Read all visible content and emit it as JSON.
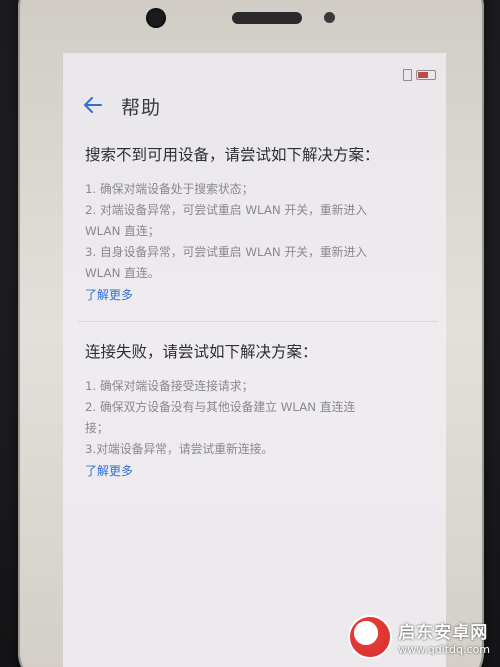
{
  "header": {
    "title": "帮助"
  },
  "sections": [
    {
      "title": "搜索不到可用设备，请尝试如下解决方案：",
      "lines": [
        "1. 确保对端设备处于搜索状态；",
        "2. 对端设备异常，可尝试重启 WLAN 开关，重新进入",
        "WLAN 直连；",
        "3. 自身设备异常，可尝试重启 WLAN 开关，重新进入",
        "WLAN 直连。"
      ],
      "link": "了解更多"
    },
    {
      "title": "连接失败，请尝试如下解决方案：",
      "lines": [
        "1. 确保对端设备接受连接请求；",
        "2. 确保双方设备没有与其他设备建立 WLAN 直连连",
        "接；",
        "3.对端设备异常，请尝试重新连接。"
      ],
      "link": "了解更多"
    }
  ],
  "watermark": {
    "name": "启东安卓网",
    "url": "www.qdltdq.com"
  },
  "colors": {
    "accent": "#2f6fd8",
    "screen_bg": "#eceaed"
  },
  "icons": {
    "back": "arrow-left-icon",
    "sim": "sim-card-icon",
    "battery": "battery-icon"
  }
}
